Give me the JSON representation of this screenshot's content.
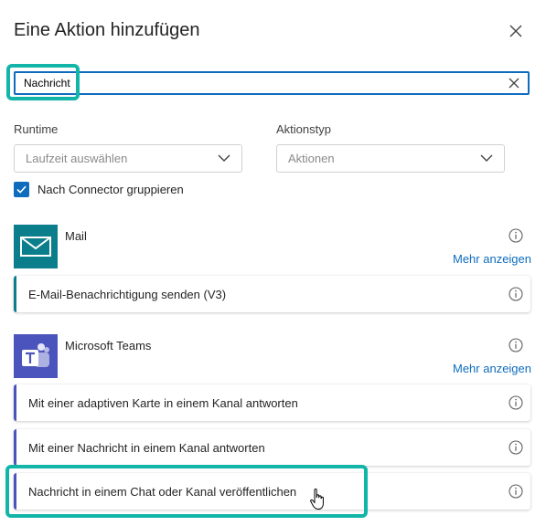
{
  "dialog": {
    "title": "Eine Aktion hinzufügen",
    "close_icon": "close-icon"
  },
  "search": {
    "value": "Nachricht",
    "clear_icon": "clear-icon"
  },
  "filters": {
    "runtime": {
      "label": "Runtime",
      "placeholder": "Laufzeit auswählen"
    },
    "action_type": {
      "label": "Aktionstyp",
      "placeholder": "Aktionen"
    },
    "group_by_connector": {
      "label": "Nach Connector gruppieren",
      "checked": true
    }
  },
  "connectors": [
    {
      "name": "Mail",
      "icon": "mail-envelope-icon",
      "color": "#0b7e8c",
      "more_label": "Mehr anzeigen",
      "actions": [
        {
          "label": "E-Mail-Benachrichtigung senden (V3)"
        }
      ]
    },
    {
      "name": "Microsoft Teams",
      "icon": "teams-icon",
      "color": "#4b53bc",
      "more_label": "Mehr anzeigen",
      "actions": [
        {
          "label": "Mit einer adaptiven Karte in einem Kanal antworten"
        },
        {
          "label": "Mit einer Nachricht in einem Kanal antworten"
        },
        {
          "label": "Nachricht in einem Chat oder Kanal veröffentlichen"
        }
      ]
    }
  ],
  "colors": {
    "accent": "#0f6cbd",
    "highlight": "#12b5a8"
  }
}
